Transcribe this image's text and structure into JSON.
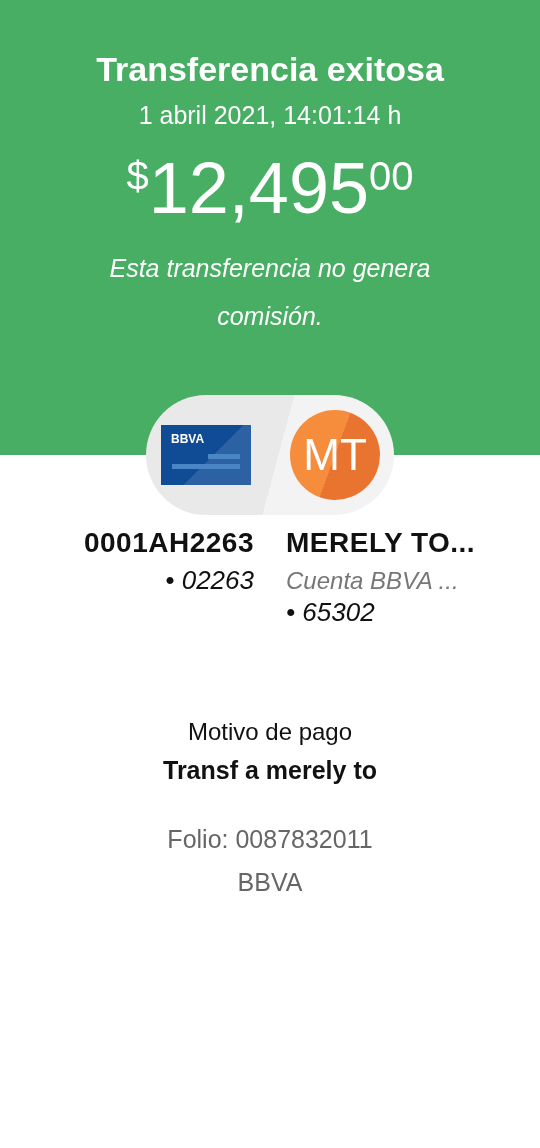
{
  "header": {
    "title": "Transferencia exitosa",
    "date": "1 abril 2021, 14:01:14 h",
    "amount": {
      "currency": "$",
      "whole": "12,495",
      "cents": "00"
    },
    "note": "Esta transferencia no genera comisión."
  },
  "origin": {
    "card_brand": "BBVA",
    "account": "0001AH2263",
    "number": "• 02263"
  },
  "destination": {
    "initials": "MT",
    "name": "MERELY TO...",
    "account_type": "Cuenta BBVA ...",
    "number": "• 65302"
  },
  "details": {
    "label": "Motivo de pago",
    "value": "Transf a merely to",
    "folio": "Folio: 0087832011",
    "bank": "BBVA"
  }
}
